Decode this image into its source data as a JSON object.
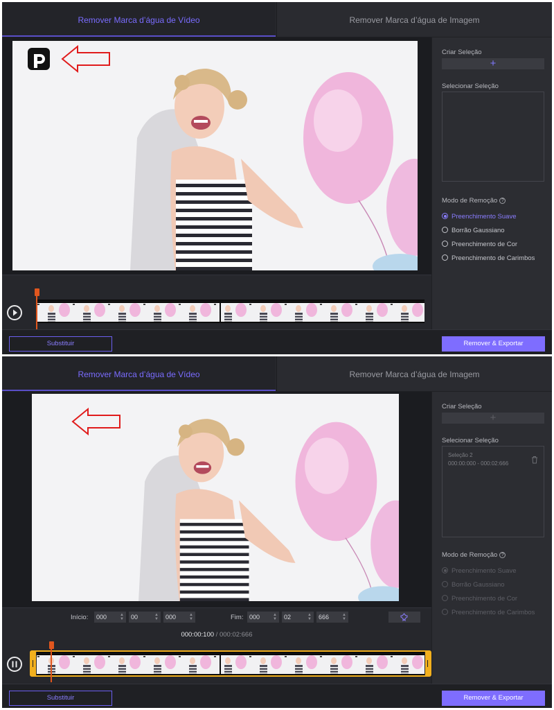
{
  "tabs": {
    "video": "Remover Marca d’água de Vídeo",
    "image": "Remover Marca d’água de Imagem"
  },
  "sidebar": {
    "create_label": "Criar Seleção",
    "create_icon": "+",
    "select_label": "Selecionar Seleção",
    "mode_label": "Modo de Remoção",
    "help_icon": "?",
    "modes": [
      "Preenchimento Suave",
      "Borrão Gaussiano",
      "Preenchimento de Cor",
      "Preenchimento de Carimbos"
    ]
  },
  "selection_item": {
    "name": "Seleção 2",
    "range": "000:00:000 - 000:02:666"
  },
  "time_controls": {
    "start_label": "Início:",
    "end_label": "Fim:",
    "start": [
      "000",
      "00",
      "000"
    ],
    "end": [
      "000",
      "02",
      "666"
    ]
  },
  "playback": {
    "current": "000:00:100",
    "separator": "/",
    "total": "000:02:666"
  },
  "buttons": {
    "substituir": "Substituir",
    "export": "Remover & Exportar"
  },
  "colors": {
    "accent": "#7e6dff",
    "playhead": "#e0561e",
    "selection_frame": "#f2b01e",
    "annotation_arrow": "#e01b1b"
  }
}
